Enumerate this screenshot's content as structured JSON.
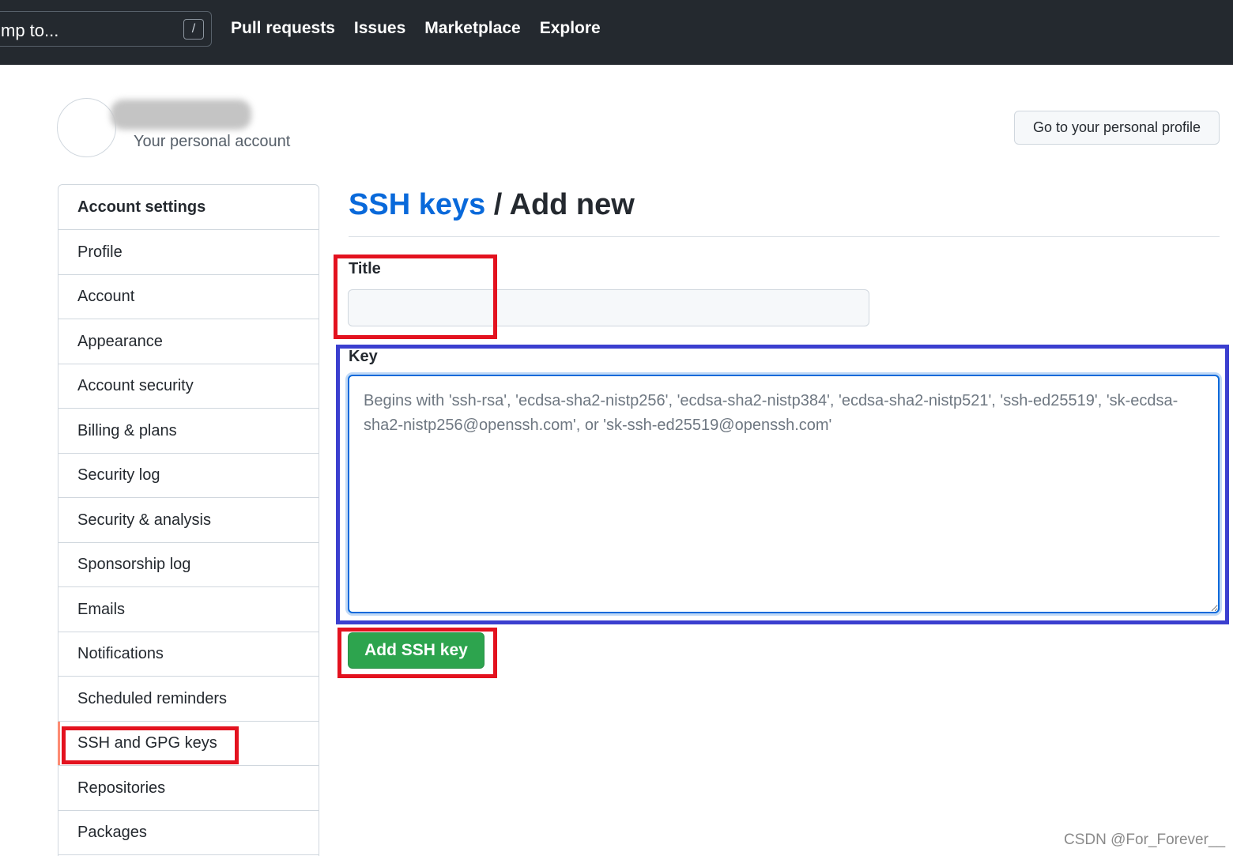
{
  "header": {
    "search_text": "mp to...",
    "search_shortcut": "/",
    "nav": [
      "Pull requests",
      "Issues",
      "Marketplace",
      "Explore"
    ]
  },
  "profile": {
    "account_label": "Your personal account",
    "profile_button": "Go to your personal profile"
  },
  "sidebar": {
    "heading": "Account settings",
    "items": [
      {
        "label": "Profile"
      },
      {
        "label": "Account"
      },
      {
        "label": "Appearance"
      },
      {
        "label": "Account security"
      },
      {
        "label": "Billing & plans"
      },
      {
        "label": "Security log"
      },
      {
        "label": "Security & analysis"
      },
      {
        "label": "Sponsorship log"
      },
      {
        "label": "Emails"
      },
      {
        "label": "Notifications"
      },
      {
        "label": "Scheduled reminders"
      },
      {
        "label": "SSH and GPG keys",
        "selected": true
      },
      {
        "label": "Repositories"
      },
      {
        "label": "Packages"
      }
    ]
  },
  "main": {
    "breadcrumb_link": "SSH keys",
    "breadcrumb_sep": " / ",
    "breadcrumb_current": "Add new",
    "title_label": "Title",
    "title_value": "",
    "key_label": "Key",
    "key_placeholder": "Begins with 'ssh-rsa', 'ecdsa-sha2-nistp256', 'ecdsa-sha2-nistp384', 'ecdsa-sha2-nistp521', 'ssh-ed25519', 'sk-ecdsa-sha2-nistp256@openssh.com', or 'sk-ssh-ed25519@openssh.com'",
    "submit_label": "Add SSH key"
  },
  "colors": {
    "header_bg": "#24292f",
    "link": "#0969da",
    "primary_button": "#2da44e",
    "annotation_red": "#e3121f",
    "annotation_blue": "#3b3fcf",
    "selected_marker": "#fd8c73"
  },
  "watermark": "CSDN @For_Forever__"
}
